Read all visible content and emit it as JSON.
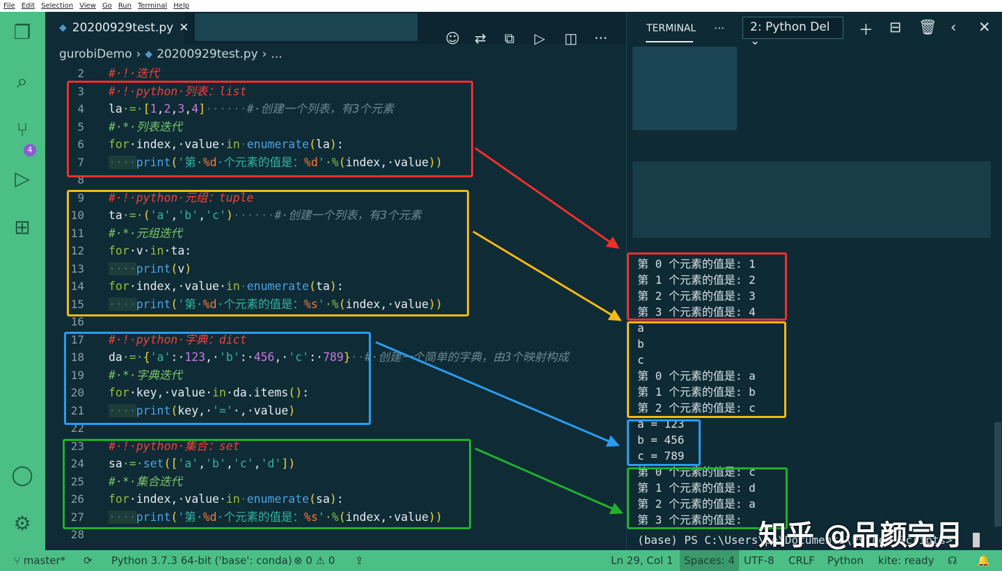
{
  "menu": [
    "File",
    "Edit",
    "Selection",
    "View",
    "Go",
    "Run",
    "Terminal",
    "Help"
  ],
  "activity": {
    "badge": "4",
    "icons": [
      "explorer-icon",
      "search-icon",
      "source-control-icon",
      "run-debug-icon",
      "extensions-icon",
      "account-icon",
      "settings-gear-icon"
    ]
  },
  "tab": {
    "filename": "20200929test.py",
    "close": "✕"
  },
  "breadcrumb": {
    "folder": "gurobiDemo",
    "file": "20200929test.py",
    "more": "..."
  },
  "code": {
    "lines": [
      {
        "n": "2",
        "t": [
          [
            "#·!·迭代",
            "cmtred"
          ]
        ]
      },
      {
        "n": "3",
        "t": [
          [
            "#·!·python·列表：list",
            "cmtred"
          ]
        ]
      },
      {
        "n": "4",
        "t": [
          [
            "la",
            "plain"
          ],
          [
            "·=·",
            "op"
          ],
          [
            "[",
            "br"
          ],
          [
            "1",
            "num"
          ],
          [
            ",",
            "plain"
          ],
          [
            "2",
            "num"
          ],
          [
            ",",
            "plain"
          ],
          [
            "3",
            "num"
          ],
          [
            ",",
            "plain"
          ],
          [
            "4",
            "num"
          ],
          [
            "]",
            "br"
          ],
          [
            "······",
            "ws"
          ],
          [
            "#·创建一个列表，有3个元素",
            "cmtgray"
          ]
        ]
      },
      {
        "n": "5",
        "t": [
          [
            "#·*·列表迭代",
            "cmtgreen"
          ]
        ]
      },
      {
        "n": "6",
        "t": [
          [
            "for",
            "kw"
          ],
          [
            "·index,·value·",
            "plain"
          ],
          [
            "in",
            "kw"
          ],
          [
            "·",
            "ws"
          ],
          [
            "enumerate",
            "fn"
          ],
          [
            "(",
            "br"
          ],
          [
            "la",
            "plain"
          ],
          [
            ")",
            "br"
          ],
          [
            ":",
            "plain"
          ]
        ]
      },
      {
        "n": "7",
        "t": [
          [
            "····",
            "indent"
          ],
          [
            "print",
            "fn"
          ],
          [
            "(",
            "br"
          ],
          [
            "'第·",
            "str"
          ],
          [
            "%d",
            "fmt"
          ],
          [
            "·个元素的值是：",
            "str"
          ],
          [
            "%d",
            "fmt"
          ],
          [
            "'",
            "str"
          ],
          [
            "·%",
            "op"
          ],
          [
            "(",
            "br"
          ],
          [
            "index,·value",
            "plain"
          ],
          [
            "))",
            "br"
          ]
        ]
      },
      {
        "n": "8",
        "t": []
      },
      {
        "n": "9",
        "t": [
          [
            "#·!·python·元组：tuple",
            "cmtred"
          ]
        ]
      },
      {
        "n": "10",
        "t": [
          [
            "ta",
            "plain"
          ],
          [
            "·=·",
            "op"
          ],
          [
            "(",
            "br"
          ],
          [
            "'a'",
            "str"
          ],
          [
            ",",
            "plain"
          ],
          [
            "'b'",
            "str"
          ],
          [
            ",",
            "plain"
          ],
          [
            "'c'",
            "str"
          ],
          [
            ")",
            "br"
          ],
          [
            "······",
            "ws"
          ],
          [
            "#·创建一个列表，有3个元素",
            "cmtgray"
          ]
        ]
      },
      {
        "n": "11",
        "t": [
          [
            "#·*·元组迭代",
            "cmtgreen"
          ]
        ]
      },
      {
        "n": "12",
        "t": [
          [
            "for",
            "kw"
          ],
          [
            "·v·",
            "plain"
          ],
          [
            "in",
            "kw"
          ],
          [
            "·ta:",
            "plain"
          ]
        ]
      },
      {
        "n": "13",
        "t": [
          [
            "····",
            "indent"
          ],
          [
            "print",
            "fn"
          ],
          [
            "(",
            "br"
          ],
          [
            "v",
            "plain"
          ],
          [
            ")",
            "br"
          ]
        ]
      },
      {
        "n": "14",
        "t": [
          [
            "for",
            "kw"
          ],
          [
            "·index,·value·",
            "plain"
          ],
          [
            "in",
            "kw"
          ],
          [
            "·",
            "ws"
          ],
          [
            "enumerate",
            "fn"
          ],
          [
            "(",
            "br"
          ],
          [
            "ta",
            "plain"
          ],
          [
            ")",
            "br"
          ],
          [
            ":",
            "plain"
          ]
        ]
      },
      {
        "n": "15",
        "t": [
          [
            "····",
            "indent"
          ],
          [
            "print",
            "fn"
          ],
          [
            "(",
            "br"
          ],
          [
            "'第·",
            "str"
          ],
          [
            "%d",
            "fmt"
          ],
          [
            "·个元素的值是：",
            "str"
          ],
          [
            "%s",
            "fmt"
          ],
          [
            "'",
            "str"
          ],
          [
            "·%",
            "op"
          ],
          [
            "(",
            "br"
          ],
          [
            "index,·value",
            "plain"
          ],
          [
            "))",
            "br"
          ]
        ]
      },
      {
        "n": "16",
        "t": []
      },
      {
        "n": "17",
        "t": [
          [
            "#·!·python·字典：dict",
            "cmtred"
          ]
        ]
      },
      {
        "n": "18",
        "t": [
          [
            "da",
            "plain"
          ],
          [
            "·=·",
            "op"
          ],
          [
            "{",
            "br"
          ],
          [
            "'a'",
            "str"
          ],
          [
            ":·",
            "plain"
          ],
          [
            "123",
            "num"
          ],
          [
            ",·",
            "plain"
          ],
          [
            "'b'",
            "str"
          ],
          [
            ":·",
            "plain"
          ],
          [
            "456",
            "num"
          ],
          [
            ",·",
            "plain"
          ],
          [
            "'c'",
            "str"
          ],
          [
            ":·",
            "plain"
          ],
          [
            "789",
            "num"
          ],
          [
            "}",
            "br"
          ],
          [
            "··",
            "ws"
          ],
          [
            "#·创建一个简单的字典，由3个映射构成",
            "cmtgray"
          ]
        ]
      },
      {
        "n": "19",
        "t": [
          [
            "#·*·字典迭代",
            "cmtgreen"
          ]
        ]
      },
      {
        "n": "20",
        "t": [
          [
            "for",
            "kw"
          ],
          [
            "·key,·value·",
            "plain"
          ],
          [
            "in",
            "kw"
          ],
          [
            "·da.items",
            "plain"
          ],
          [
            "()",
            "br"
          ],
          [
            ":",
            "plain"
          ]
        ]
      },
      {
        "n": "21",
        "t": [
          [
            "····",
            "indent"
          ],
          [
            "print",
            "fn"
          ],
          [
            "(",
            "br"
          ],
          [
            "key,·",
            "plain"
          ],
          [
            "'='",
            "str"
          ],
          [
            "·,·value",
            "plain"
          ],
          [
            ")",
            "br"
          ]
        ]
      },
      {
        "n": "22",
        "t": []
      },
      {
        "n": "23",
        "t": [
          [
            "#·!·python·集合：set",
            "cmtred"
          ]
        ]
      },
      {
        "n": "24",
        "t": [
          [
            "sa",
            "plain"
          ],
          [
            "·=·",
            "op"
          ],
          [
            "set",
            "fn"
          ],
          [
            "(",
            "br"
          ],
          [
            "[",
            "br"
          ],
          [
            "'a'",
            "str"
          ],
          [
            ",",
            "plain"
          ],
          [
            "'b'",
            "str"
          ],
          [
            ",",
            "plain"
          ],
          [
            "'c'",
            "str"
          ],
          [
            ",",
            "plain"
          ],
          [
            "'d'",
            "str"
          ],
          [
            "]",
            "br"
          ],
          [
            ")",
            "br"
          ]
        ]
      },
      {
        "n": "25",
        "t": [
          [
            "#·*·集合迭代",
            "cmtgreen"
          ]
        ]
      },
      {
        "n": "26",
        "t": [
          [
            "for",
            "kw"
          ],
          [
            "·index,·value·",
            "plain"
          ],
          [
            "in",
            "kw"
          ],
          [
            "·",
            "ws"
          ],
          [
            "enumerate",
            "fn"
          ],
          [
            "(",
            "br"
          ],
          [
            "sa",
            "plain"
          ],
          [
            ")",
            "br"
          ],
          [
            ":",
            "plain"
          ]
        ]
      },
      {
        "n": "27",
        "t": [
          [
            "····",
            "indent"
          ],
          [
            "print",
            "fn"
          ],
          [
            "(",
            "br"
          ],
          [
            "'第·",
            "str"
          ],
          [
            "%d",
            "fmt"
          ],
          [
            "·个元素的值是：",
            "str"
          ],
          [
            "%s",
            "fmt"
          ],
          [
            "'",
            "str"
          ],
          [
            "·%",
            "op"
          ],
          [
            "(",
            "br"
          ],
          [
            "index,·value",
            "plain"
          ],
          [
            "))",
            "br"
          ]
        ]
      },
      {
        "n": "28",
        "t": []
      }
    ]
  },
  "terminal": {
    "tab_label": "TERMINAL",
    "more": "···",
    "selected": "2: Python Del",
    "dropdown": "⌄",
    "output": [
      "第 0 个元素的值是: 1",
      "第 1 个元素的值是: 2",
      "第 2 个元素的值是: 3",
      "第 3 个元素的值是: 4",
      "a",
      "b",
      "c",
      "第 0 个元素的值是: a",
      "第 1 个元素的值是: b",
      "第 2 个元素的值是: c",
      "a = 123",
      "b = 456",
      "c = 789",
      "第 0 个元素的值是: c",
      "第 1 个元素的值是: d",
      "第 2 个元素的值是: a",
      "第 3 个元素的值是:"
    ],
    "prompt": "(base) PS C:\\Users\\pe\\Documents\\Python Scripts>"
  },
  "watermark": "知乎 @品颜完月",
  "colors": {
    "red": "#f0302a",
    "yellow": "#f5b914",
    "blue": "#2a9cf0",
    "green": "#22b02c",
    "accent": "#4cbf86"
  },
  "status": {
    "branch": "master*",
    "interpreter": "Python 3.7.3 64-bit ('base': conda)",
    "errors": "0",
    "warnings": "0",
    "position": "Ln 29, Col 1",
    "spaces": "Spaces: 4",
    "encoding": "UTF-8",
    "eol": "CRLF",
    "language": "Python",
    "kite": "kite: ready"
  }
}
